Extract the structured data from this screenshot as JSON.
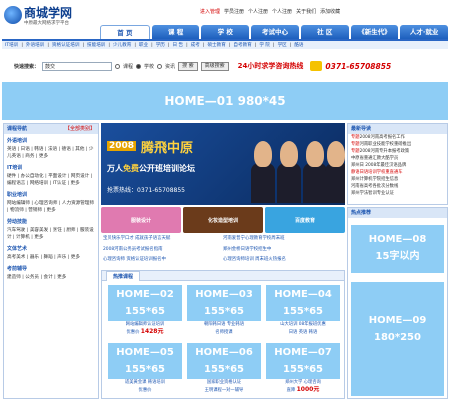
{
  "header": {
    "site_name": "商城学网",
    "slogan": "中原最大网络求学平台",
    "top_links": [
      "进入管理",
      "学员注册",
      "个人注册",
      "个人注册",
      "关于我们",
      "添加收藏"
    ],
    "nav_tabs": [
      "首 页",
      "课 程",
      "学 校",
      "考试中心",
      "社 区",
      "《新生代》",
      "人才·就业"
    ],
    "subnav": [
      "IT培训",
      "外语培训",
      "资格认证培训",
      "技能培训",
      "少儿教育",
      "职业",
      "学历",
      "日 告",
      "成考",
      "硕士教育",
      "自考教育",
      "学 院",
      "学区",
      "酷语"
    ]
  },
  "search": {
    "label": "快速搜索：",
    "value": "鼓交",
    "options": [
      "课程",
      "学校",
      "资讯"
    ],
    "selected": "学校",
    "search_button": "搜 索",
    "advanced_button": "高级搜索",
    "hotline_text": "24小时求学咨询热线",
    "phone": "0371-65708855"
  },
  "ads": {
    "home01": "HOME—01   980*45",
    "home08_title": "HOME—08",
    "home08_sub": "15字以内",
    "home09_title": "HOME—09",
    "home09_sub": "180*250"
  },
  "left_nav": {
    "title": "课程导航",
    "all_link": "【全部类别】",
    "sections": [
      {
        "name": "外语培训",
        "items": "英语 | 日语 | 韩语 | 法语 | 德语 | 其他 | 少儿英语 | 商务 | 更多"
      },
      {
        "name": "IT培训",
        "items": "硬件 | 办公自动化 | 平面设计 | 网页设计 | 编程语言 | 网络培训 | IT认证 | 更多"
      },
      {
        "name": "职业培训",
        "items": "网站编辑师 | 心理咨询师 | 人力资源管理师 | 物流师 | 营销师 | 更多"
      },
      {
        "name": "劳动技能",
        "items": "汽车驾驶 | 美容美发 | 烹饪 | 厨师 | 服装设计 | 计算机 | 更多"
      },
      {
        "name": "文体艺术",
        "items": "高考美术 | 器乐 | 舞蹈 | 声乐 | 更多"
      },
      {
        "name": "考前辅导",
        "items": "建造师 | 公务员 | 会计 | 更多"
      }
    ]
  },
  "banner": {
    "year": "2008",
    "headline": "腾飛中原",
    "sub_a": "万人",
    "sub_free": "免费",
    "sub_b": "公开班培训论坛",
    "tel": "抢票热线：0371-65708855"
  },
  "ad_row": [
    "服装设计",
    "化妆造型培训",
    "百度教育"
  ],
  "news": [
    "宝贝快乐学口才 成就孩子语言天赋",
    "河南爱普宁心理教育学校周末班",
    "2008河南公务员考试报名指南",
    "郑州金桥日语学校招生中",
    "心理咨询师 资格认证培训报名中",
    "心理咨询师培训 周末班火热报名"
  ],
  "hot_courses": {
    "tab": "热推课程",
    "items": [
      {
        "title": "HOME—02",
        "size": "155*65",
        "cap": "网站编辑师认证培训",
        "cap2": "优惠价 ",
        "price": "1428元"
      },
      {
        "title": "HOME—03",
        "size": "155*65",
        "cap": "朝阳韩日语 专业韩语",
        "cap2": "名师授课 ",
        "price": ""
      },
      {
        "title": "HOME—04",
        "size": "155*65",
        "cap": "山大培训 08年报班优惠",
        "cap2": "日语 英语 韩语",
        "price": ""
      },
      {
        "title": "HOME—05",
        "size": "155*65",
        "cap": "适美黄金课 韩语培训",
        "cap2": "优惠价",
        "price": ""
      },
      {
        "title": "HOME—06",
        "size": "155*65",
        "cap": "国家职业资格认证",
        "cap2": "王明课程一对一辅导",
        "price": ""
      },
      {
        "title": "HOME—07",
        "size": "155*65",
        "cap": "郑州大学 心理咨询",
        "cap2": "直降 ",
        "price": "1000元"
      }
    ]
  },
  "right_news": {
    "title": "最新导读",
    "items": [
      {
        "tag": "专题",
        "text": "2008河南高考报名工作"
      },
      {
        "tag": "专题",
        "text": "河南职业技能学校重磅推出"
      },
      {
        "tag": "专题",
        "text": "2008河南专升本报考政策"
      },
      {
        "tag": "",
        "text": "中原省重通汇教大酷学员"
      },
      {
        "tag": "",
        "text": "郑州日 2008年最佳汉语品牌"
      },
      {
        "tag": "",
        "text": "静语日语培训学校重直通车"
      },
      {
        "tag": "",
        "text": "郑州计算机学院招生信息"
      },
      {
        "tag": "",
        "text": "河南省高考各批次分数线"
      },
      {
        "tag": "",
        "text": "郑州学法智训专业认证"
      }
    ],
    "hot_title": "热点推荐"
  },
  "colors": {
    "brand_blue": "#1c55b0",
    "accent_red": "#d40000",
    "placeholder": "#8ecdf5"
  }
}
